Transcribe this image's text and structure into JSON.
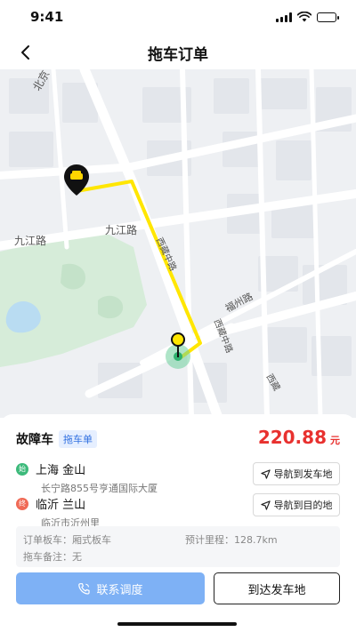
{
  "status_bar": {
    "time": "9:41"
  },
  "nav": {
    "title": "拖车订单"
  },
  "map": {
    "labels": {
      "beijing_road": "北京",
      "jiujiang_road_left": "九江路",
      "jiujiang_road_right": "九江路",
      "xizang_middle_upper": "西藏中路",
      "xizang_middle_lower": "西藏中路",
      "fuzhou_road": "福州路",
      "xizang_edge": "西藏"
    },
    "route_color": "#ffe600"
  },
  "order": {
    "title": "故障车",
    "tag": "拖车单",
    "price": "220.88",
    "price_unit": "元"
  },
  "pickup": {
    "badge": "始",
    "title": "上海  金山",
    "address": "长宁路855号亨通国际大厦",
    "nav_label": "导航到发车地",
    "color": "#3dba7b"
  },
  "dropoff": {
    "badge": "终",
    "title": "临沂  兰山",
    "address": "临沂市沂州里",
    "nav_label": "导航到目的地",
    "color": "#f06a56"
  },
  "details": {
    "trailer_plate": "订单板车：厢式板车",
    "estimated_mileage": "预计里程：128.7km",
    "tow_note": "拖车备注：无"
  },
  "actions": {
    "contact_label": "联系调度",
    "arrive_label": "到达发车地"
  }
}
